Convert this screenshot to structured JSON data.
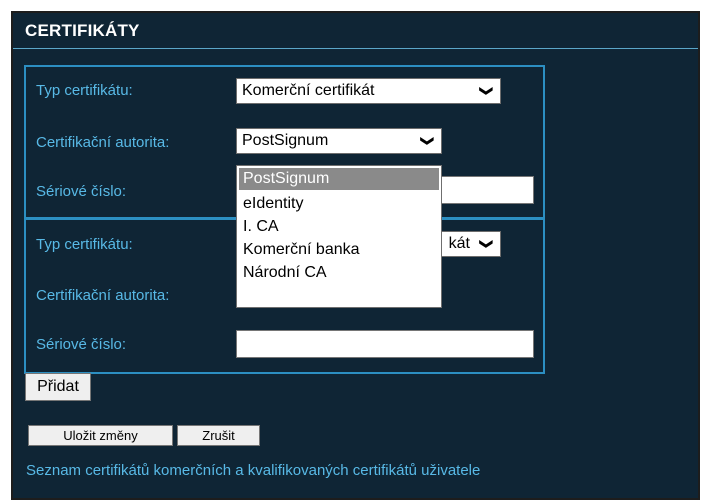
{
  "panel": {
    "title": "CERTIFIKÁTY"
  },
  "form1": {
    "type_label": "Typ certifikátu:",
    "type_value": "Komerční certifikát",
    "authority_label": "Certifikační autorita:",
    "authority_value": "PostSignum",
    "serial_label": "Sériové číslo:",
    "serial_value": ""
  },
  "form2": {
    "type_label": "Typ certifikátu:",
    "type_value_visible": "kát",
    "authority_label": "Certifikační autorita:",
    "serial_label": "Sériové číslo:",
    "serial_value": ""
  },
  "dropdown": {
    "options": [
      "PostSignum",
      "eIdentity",
      "I. CA",
      "Komerční banka",
      "Národní CA"
    ],
    "selected_index": 0
  },
  "buttons": {
    "add": "Přidat",
    "save": "Uložit změny",
    "cancel": "Zrušit"
  },
  "footer": {
    "link_text": "Seznam certifikátů komerčních a kvalifikovaných certifikátů uživatele"
  },
  "icons": {
    "select_arrow": "chevron-down-icon"
  },
  "colors": {
    "background": "#0f2535",
    "label": "#58b9e6",
    "border": "#2c8fc2",
    "title": "#ffffff"
  }
}
